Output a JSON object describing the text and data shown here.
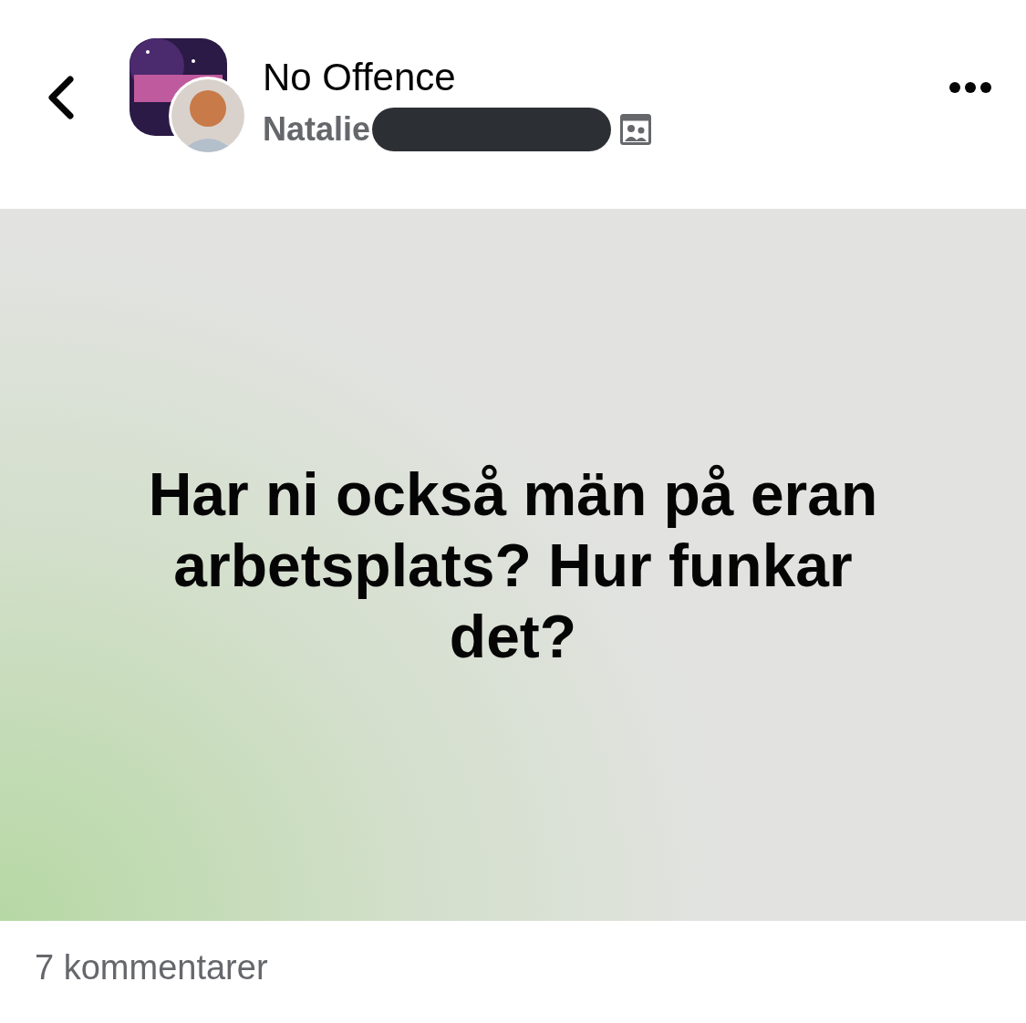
{
  "group": {
    "name": "No Offence"
  },
  "author": {
    "name": "Natalie",
    "redacted": true
  },
  "post": {
    "text": "Har ni också män på eran arbetsplats? Hur funkar det?"
  },
  "footer": {
    "comments": "7 kommentarer"
  }
}
